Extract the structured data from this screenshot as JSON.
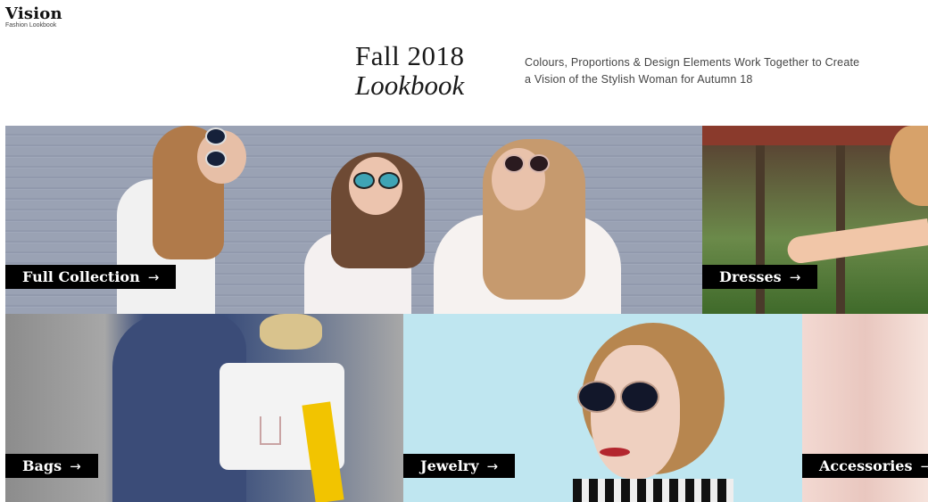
{
  "brand": {
    "title": "Vision",
    "subtitle": "Fashion Lookbook"
  },
  "hero": {
    "line1": "Fall 2018",
    "line2": "Lookbook",
    "description": "Colours, Proportions & Design Elements Work Together to Create a Vision of the Stylish Woman for Autumn 18"
  },
  "tiles": [
    {
      "label": "Full Collection",
      "arrow": "→"
    },
    {
      "label": "Dresses",
      "arrow": "→"
    },
    {
      "label": "Bags",
      "arrow": "→"
    },
    {
      "label": "Jewelry",
      "arrow": "→"
    },
    {
      "label": "Accessories",
      "arrow": "→"
    }
  ],
  "colors": {
    "label_bg": "#000000",
    "label_text": "#ffffff",
    "page_bg": "#ffffff"
  }
}
